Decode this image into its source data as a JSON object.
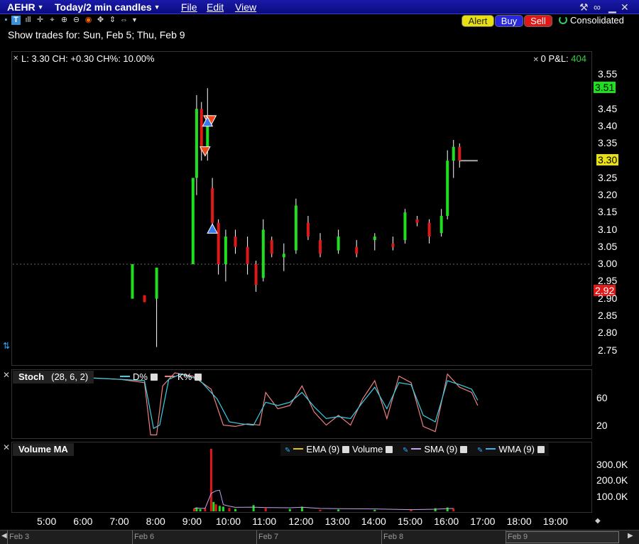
{
  "window": {
    "symbol": "AEHR",
    "timeframe": "Today/2 min candles",
    "menus": [
      "File",
      "Edit",
      "View"
    ]
  },
  "toolbar": {
    "alert_label": "Alert",
    "buy_label": "Buy",
    "sell_label": "Sell",
    "consolidated_label": "Consolidated",
    "colors": {
      "alert": "#e8e010",
      "buy": "#2828e0",
      "sell": "#e01818",
      "up": "#1ee01e",
      "down": "#e01818"
    }
  },
  "show_trades": "Show trades for:  Sun, Feb 5; Thu, Feb 9",
  "info": {
    "quote": "L: 3.30 CH: +0.30 CH%: 10.00%",
    "pnl_label": "0 P&L:",
    "pnl_value": "404"
  },
  "price_axis": {
    "ticks": [
      "3.55",
      "3.51",
      "3.45",
      "3.40",
      "3.35",
      "3.30",
      "3.25",
      "3.20",
      "3.15",
      "3.10",
      "3.05",
      "3.00",
      "2.95",
      "2.92",
      "2.90",
      "2.85",
      "2.80",
      "2.75"
    ],
    "tag_high": "3.51",
    "tag_last": "3.30",
    "tag_low": "2.92"
  },
  "stoch": {
    "title": "Stoch",
    "params": "(28, 6, 2)",
    "d_label": "D%",
    "k_label": "K%",
    "ticks": [
      "60",
      "20"
    ]
  },
  "volume": {
    "title": "Volume MA",
    "legend": [
      "EMA (9)",
      "Volume",
      "SMA (9)",
      "WMA (9)"
    ],
    "ticks": [
      "300.0K",
      "200.0K",
      "100.0K"
    ]
  },
  "time_axis": [
    "5:00",
    "6:00",
    "7:00",
    "8:00",
    "9:00",
    "10:00",
    "11:00",
    "12:00",
    "13:00",
    "14:00",
    "15:00",
    "16:00",
    "17:00",
    "18:00",
    "19:00"
  ],
  "date_bar": [
    "Feb 3",
    "Feb 6",
    "Feb 7",
    "Feb 8",
    "Feb 9"
  ],
  "chart_data": {
    "type": "candlestick",
    "x_unit": "time of day",
    "ylim": [
      2.72,
      3.57
    ],
    "last": 3.3,
    "prev_close": 3.0,
    "candles": [
      {
        "t": "7:20",
        "o": 2.9,
        "h": 3.0,
        "l": 2.9,
        "c": 3.0
      },
      {
        "t": "7:40",
        "o": 2.91,
        "h": 2.91,
        "l": 2.89,
        "c": 2.89
      },
      {
        "t": "8:00",
        "o": 2.9,
        "h": 2.99,
        "l": 2.76,
        "c": 2.99
      },
      {
        "t": "9:00",
        "o": 3.0,
        "h": 3.25,
        "l": 3.0,
        "c": 3.25
      },
      {
        "t": "9:06",
        "o": 3.25,
        "h": 3.49,
        "l": 3.2,
        "c": 3.45
      },
      {
        "t": "9:14",
        "o": 3.45,
        "h": 3.47,
        "l": 3.3,
        "c": 3.33
      },
      {
        "t": "9:24",
        "o": 3.33,
        "h": 3.51,
        "l": 3.3,
        "c": 3.4
      },
      {
        "t": "9:32",
        "o": 3.22,
        "h": 3.25,
        "l": 3.1,
        "c": 3.12
      },
      {
        "t": "9:42",
        "o": 3.12,
        "h": 3.13,
        "l": 2.97,
        "c": 3.0
      },
      {
        "t": "9:54",
        "o": 3.0,
        "h": 3.1,
        "l": 2.95,
        "c": 3.08
      },
      {
        "t": "10:10",
        "o": 3.08,
        "h": 3.1,
        "l": 3.03,
        "c": 3.05
      },
      {
        "t": "10:30",
        "o": 3.05,
        "h": 3.08,
        "l": 2.97,
        "c": 3.0
      },
      {
        "t": "10:44",
        "o": 3.0,
        "h": 3.01,
        "l": 2.92,
        "c": 2.94
      },
      {
        "t": "10:56",
        "o": 2.96,
        "h": 3.13,
        "l": 2.95,
        "c": 3.1
      },
      {
        "t": "11:10",
        "o": 3.07,
        "h": 3.08,
        "l": 3.02,
        "c": 3.03
      },
      {
        "t": "11:30",
        "o": 3.02,
        "h": 3.06,
        "l": 2.98,
        "c": 3.03
      },
      {
        "t": "11:50",
        "o": 3.04,
        "h": 3.19,
        "l": 3.03,
        "c": 3.17
      },
      {
        "t": "12:10",
        "o": 3.12,
        "h": 3.14,
        "l": 3.07,
        "c": 3.08
      },
      {
        "t": "12:30",
        "o": 3.07,
        "h": 3.09,
        "l": 3.02,
        "c": 3.03
      },
      {
        "t": "13:00",
        "o": 3.04,
        "h": 3.1,
        "l": 3.03,
        "c": 3.08
      },
      {
        "t": "13:30",
        "o": 3.05,
        "h": 3.07,
        "l": 3.02,
        "c": 3.03
      },
      {
        "t": "14:00",
        "o": 3.07,
        "h": 3.09,
        "l": 3.04,
        "c": 3.08
      },
      {
        "t": "14:30",
        "o": 3.06,
        "h": 3.08,
        "l": 3.04,
        "c": 3.05
      },
      {
        "t": "14:50",
        "o": 3.07,
        "h": 3.16,
        "l": 3.06,
        "c": 3.15
      },
      {
        "t": "15:10",
        "o": 3.13,
        "h": 3.14,
        "l": 3.11,
        "c": 3.12
      },
      {
        "t": "15:30",
        "o": 3.12,
        "h": 3.13,
        "l": 3.06,
        "c": 3.08
      },
      {
        "t": "15:50",
        "o": 3.09,
        "h": 3.16,
        "l": 3.08,
        "c": 3.14
      },
      {
        "t": "16:00",
        "o": 3.14,
        "h": 3.33,
        "l": 3.13,
        "c": 3.3
      },
      {
        "t": "16:10",
        "o": 3.3,
        "h": 3.36,
        "l": 3.25,
        "c": 3.34
      },
      {
        "t": "16:20",
        "o": 3.34,
        "h": 3.35,
        "l": 3.28,
        "c": 3.3
      }
    ],
    "trade_markers": [
      {
        "t": "9:26",
        "price": 3.42,
        "side": "sell"
      },
      {
        "t": "9:30",
        "price": 3.42,
        "side": "sell"
      },
      {
        "t": "9:24",
        "price": 3.41,
        "side": "buy"
      },
      {
        "t": "9:20",
        "price": 3.33,
        "side": "sell"
      },
      {
        "t": "9:32",
        "price": 3.1,
        "side": "buy"
      }
    ],
    "stoch_k": [
      {
        "t": "5:00",
        "v": 96
      },
      {
        "t": "7:00",
        "v": 90
      },
      {
        "t": "7:40",
        "v": 85
      },
      {
        "t": "7:50",
        "v": 5
      },
      {
        "t": "8:00",
        "v": 5
      },
      {
        "t": "8:10",
        "v": 80
      },
      {
        "t": "8:30",
        "v": 100
      },
      {
        "t": "9:00",
        "v": 95
      },
      {
        "t": "9:30",
        "v": 75
      },
      {
        "t": "9:50",
        "v": 20
      },
      {
        "t": "10:10",
        "v": 18
      },
      {
        "t": "10:30",
        "v": 22
      },
      {
        "t": "10:50",
        "v": 20
      },
      {
        "t": "11:00",
        "v": 70
      },
      {
        "t": "11:20",
        "v": 45
      },
      {
        "t": "11:40",
        "v": 50
      },
      {
        "t": "12:00",
        "v": 80
      },
      {
        "t": "12:20",
        "v": 40
      },
      {
        "t": "12:40",
        "v": 20
      },
      {
        "t": "13:00",
        "v": 35
      },
      {
        "t": "13:20",
        "v": 20
      },
      {
        "t": "13:40",
        "v": 60
      },
      {
        "t": "14:00",
        "v": 88
      },
      {
        "t": "14:20",
        "v": 30
      },
      {
        "t": "14:40",
        "v": 95
      },
      {
        "t": "15:00",
        "v": 85
      },
      {
        "t": "15:20",
        "v": 18
      },
      {
        "t": "15:40",
        "v": 10
      },
      {
        "t": "16:00",
        "v": 98
      },
      {
        "t": "16:20",
        "v": 78
      },
      {
        "t": "16:40",
        "v": 70
      },
      {
        "t": "16:50",
        "v": 50
      }
    ],
    "stoch_d": [
      {
        "t": "5:00",
        "v": 95
      },
      {
        "t": "7:00",
        "v": 90
      },
      {
        "t": "7:40",
        "v": 88
      },
      {
        "t": "7:55",
        "v": 15
      },
      {
        "t": "8:05",
        "v": 20
      },
      {
        "t": "8:20",
        "v": 90
      },
      {
        "t": "8:40",
        "v": 98
      },
      {
        "t": "9:10",
        "v": 90
      },
      {
        "t": "9:40",
        "v": 60
      },
      {
        "t": "10:00",
        "v": 25
      },
      {
        "t": "10:20",
        "v": 22
      },
      {
        "t": "10:40",
        "v": 20
      },
      {
        "t": "11:00",
        "v": 55
      },
      {
        "t": "11:20",
        "v": 50
      },
      {
        "t": "11:40",
        "v": 55
      },
      {
        "t": "12:00",
        "v": 70
      },
      {
        "t": "12:20",
        "v": 48
      },
      {
        "t": "12:40",
        "v": 30
      },
      {
        "t": "13:00",
        "v": 33
      },
      {
        "t": "13:20",
        "v": 30
      },
      {
        "t": "13:40",
        "v": 55
      },
      {
        "t": "14:00",
        "v": 78
      },
      {
        "t": "14:20",
        "v": 45
      },
      {
        "t": "14:40",
        "v": 85
      },
      {
        "t": "15:00",
        "v": 82
      },
      {
        "t": "15:20",
        "v": 35
      },
      {
        "t": "15:40",
        "v": 25
      },
      {
        "t": "16:00",
        "v": 88
      },
      {
        "t": "16:20",
        "v": 82
      },
      {
        "t": "16:40",
        "v": 75
      },
      {
        "t": "16:50",
        "v": 58
      }
    ],
    "volume": [
      {
        "t": "9:02",
        "v": 18000
      },
      {
        "t": "9:06",
        "v": 25000
      },
      {
        "t": "9:12",
        "v": 15000
      },
      {
        "t": "9:20",
        "v": 20000
      },
      {
        "t": "9:30",
        "v": 400000
      },
      {
        "t": "9:34",
        "v": 60000
      },
      {
        "t": "9:38",
        "v": 45000
      },
      {
        "t": "9:44",
        "v": 35000
      },
      {
        "t": "9:50",
        "v": 30000
      },
      {
        "t": "10:00",
        "v": 22000
      },
      {
        "t": "10:10",
        "v": 15000
      },
      {
        "t": "10:40",
        "v": 40000
      },
      {
        "t": "11:00",
        "v": 20000
      },
      {
        "t": "11:40",
        "v": 15000
      },
      {
        "t": "12:00",
        "v": 30000
      },
      {
        "t": "12:30",
        "v": 10000
      },
      {
        "t": "13:00",
        "v": 12000
      },
      {
        "t": "14:00",
        "v": 10000
      },
      {
        "t": "15:00",
        "v": 12000
      },
      {
        "t": "15:40",
        "v": 20000
      },
      {
        "t": "16:00",
        "v": 25000
      },
      {
        "t": "16:10",
        "v": 18000
      }
    ]
  }
}
